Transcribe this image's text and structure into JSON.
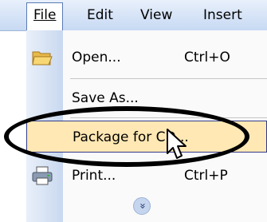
{
  "menubar": {
    "file": "File",
    "edit": "Edit",
    "view": "View",
    "insert": "Insert"
  },
  "menu": {
    "open_label": "Open...",
    "open_shortcut": "Ctrl+O",
    "saveas_label": "Save As...",
    "package_label": "Package for CD...",
    "print_label": "Print...",
    "print_shortcut": "Ctrl+P",
    "expand": "»"
  },
  "icons": {
    "open": "folder-open-icon",
    "print": "printer-icon",
    "expand": "chevron-double-down-icon",
    "cursor": "mouse-pointer-icon"
  },
  "colors": {
    "menubar": "#c7d9f3",
    "highlight": "#ffe8b4",
    "highlight_border": "#313a8a"
  }
}
